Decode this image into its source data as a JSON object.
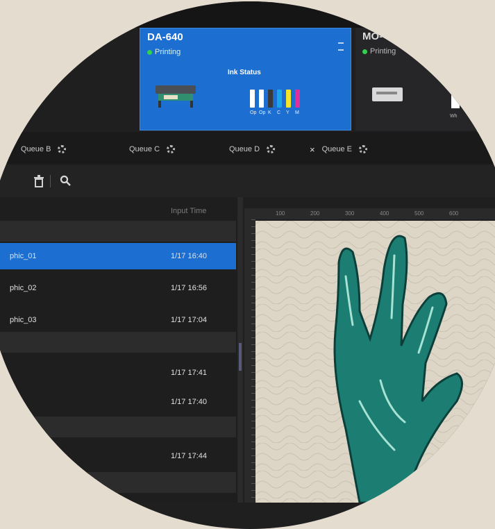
{
  "printers": [
    {
      "name": "DA-640",
      "status": "Printing",
      "selected": true
    },
    {
      "name": "MO-",
      "status": "Printing",
      "selected": false
    }
  ],
  "ink": {
    "title": "Ink Status",
    "labels": [
      "Op",
      "Op",
      "K",
      "C",
      "Y",
      "M"
    ],
    "colors": [
      "#ffffff",
      "#ffffff",
      "#3a3a3a",
      "#1aa6e8",
      "#f2e52a",
      "#e02d9d"
    ]
  },
  "second_printer_tag": "Wh",
  "queues": [
    {
      "label": "Queue B"
    },
    {
      "label": "Queue C"
    },
    {
      "label": "Queue D"
    },
    {
      "label": "Queue E"
    }
  ],
  "queue_close_glyph": "×",
  "list": {
    "header_time": "Input Time",
    "rows": [
      {
        "name": "phic_01",
        "time": "1/17 16:40",
        "selected": true
      },
      {
        "name": "phic_02",
        "time": "1/17 16:56",
        "selected": false
      },
      {
        "name": "phic_03",
        "time": "1/17 17:04",
        "selected": false
      },
      {
        "name": "",
        "time": "1/17 17:41",
        "selected": false
      },
      {
        "name": "",
        "time": "1/17 17:40",
        "selected": false
      },
      {
        "name": "",
        "time": "1/17 17:44",
        "selected": false
      }
    ]
  },
  "ruler_ticks": [
    "100",
    "200",
    "300",
    "400",
    "500",
    "600"
  ],
  "colors": {
    "accent": "#1c6fd1",
    "status_green": "#33d04e",
    "artwork_teal": "#1c7d72"
  }
}
